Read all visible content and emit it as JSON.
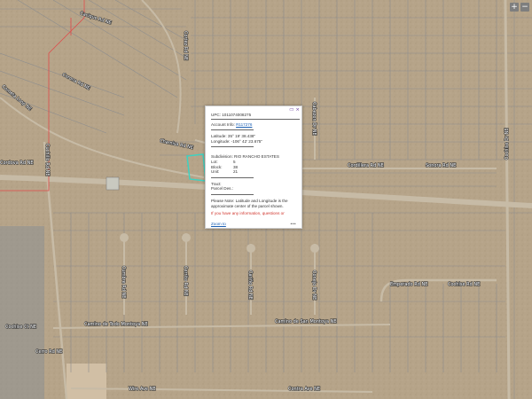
{
  "map": {
    "road_labels": [
      "Cordillera Rd NE",
      "Sonora Rd NE",
      "Cochise Rd NE",
      "Emperado Rd NE",
      "Cacique Rd NE",
      "Corona Rd NE",
      "Cordova Rd NE",
      "Cometa Loop NE",
      "Cuchillo Rd NE",
      "Camino de Todo Montoya NE",
      "Camino de San Montoya NE",
      "Wire Ave NE",
      "Contra Ave NE",
      "Cochise Dr NE",
      "Cochise Ct NE",
      "Cumbre Rd NE",
      "Cerrito Rd NE",
      "Cariño Rd NE",
      "Conejo Dr NE",
      "Cabezon Dr NE",
      "Cortez Rd NE",
      "Chamisa Rd NE",
      "Cerro Rd NE"
    ],
    "colors": {
      "ground": "#b9a78c",
      "parcel_line": "#8e8e8e",
      "selected_parcel": "#3fd1c0",
      "boundary": "#e04a4a",
      "popup_controls": "#6a3f9e"
    }
  },
  "zoom_controls": {
    "zoom_in": "+",
    "zoom_out": "−"
  },
  "popup": {
    "controls": {
      "dock_icon": "dock-icon",
      "close_icon": "close-icon",
      "close_glyph": "×",
      "dock_glyph": "▭"
    },
    "upc": "UPC: 1011074008275",
    "account_label": "Account Info: ",
    "account_link": "R117276",
    "latitude": "Latitude: 35° 19' 38.438\"",
    "longitude": "Longitude: -106° 42' 23.675\"",
    "subdivision": "Subdivision: RIO RANCHO ESTATES",
    "lot_label": "Lot:",
    "lot_value": "5",
    "block_label": "Block:",
    "block_value": "38",
    "unit_label": "Unit:",
    "unit_value": "21",
    "tract": "Tract:",
    "parcel_des": "Parcel Des.:",
    "note": "Please Note: Latitude and Longitude is the approximate center of the parcel shown.",
    "info_text": "If you have any information, questions or",
    "zoom_link": "Zoom to",
    "more": "•••"
  }
}
